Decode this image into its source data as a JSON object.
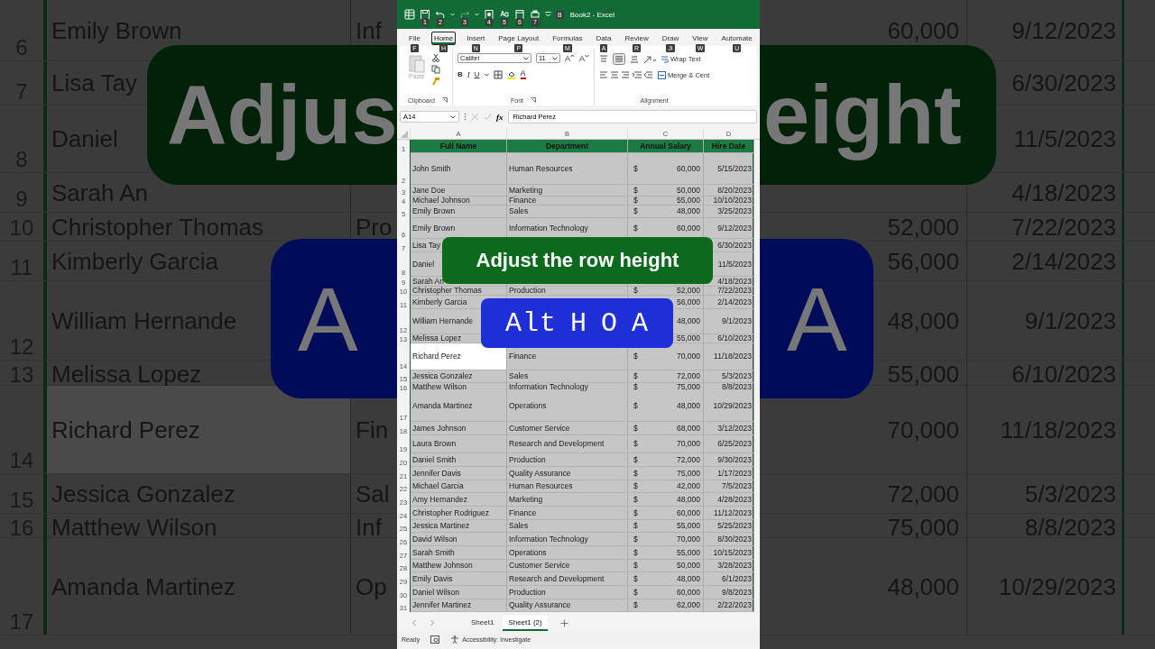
{
  "backdrop": {
    "left": {
      "rows": [
        {
          "number": "6",
          "name": "Emily Brown",
          "department": "Inf",
          "active": false
        },
        {
          "number": "7",
          "name": "Lisa Tay",
          "active": false
        },
        {
          "number": "8",
          "name": "Daniel",
          "active": false
        },
        {
          "number": "9",
          "name": "Sarah An",
          "active": false
        },
        {
          "number": "10",
          "name": "Christopher Thomas",
          "department": "Pro",
          "active": false
        },
        {
          "number": "11",
          "name": "Kimberly Garcia",
          "active": false
        },
        {
          "number": "12",
          "name": "William Hernande",
          "active": false
        },
        {
          "number": "13",
          "name": "Melissa Lopez",
          "active": false
        },
        {
          "number": "14",
          "name": "Richard Perez",
          "department": "Fin",
          "active": true
        },
        {
          "number": "15",
          "name": "Jessica Gonzalez",
          "department": "Sal",
          "active": false
        },
        {
          "number": "16",
          "name": "Matthew Wilson",
          "department": "Inf",
          "active": false
        },
        {
          "number": "17",
          "name": "Amanda Martinez",
          "department": "Op",
          "active": false
        }
      ],
      "caption": "Adjus",
      "shortcut": "A"
    },
    "right": {
      "rows": [
        {
          "salary": "60,000",
          "date": "9/12/2023"
        },
        {
          "date": "6/30/2023"
        },
        {
          "date": "11/5/2023"
        },
        {
          "date": "4/18/2023"
        },
        {
          "salary": "52,000",
          "date": "7/22/2023"
        },
        {
          "salary": "56,000",
          "date": "2/14/2023"
        },
        {
          "salary": "48,000",
          "date": "9/1/2023"
        },
        {
          "salary": "55,000",
          "date": "6/10/2023"
        },
        {
          "salary": "70,000",
          "date": "11/18/2023"
        },
        {
          "salary": "72,000",
          "date": "5/3/2023"
        },
        {
          "salary": "75,000",
          "date": "8/8/2023"
        },
        {
          "salary": "48,000",
          "date": "10/29/2023"
        }
      ],
      "caption": "eight",
      "shortcut": "A"
    }
  },
  "window": {
    "title": "Book2 - Excel",
    "title_keytip": "B",
    "quick_access": [
      {
        "kind": "save",
        "keytip": "1",
        "disabled": false
      },
      {
        "kind": "undo",
        "keytip": "2",
        "disabled": false
      },
      {
        "kind": "redo",
        "keytip": "3",
        "disabled": true
      },
      {
        "kind": "touch",
        "keytip": "4",
        "disabled": false
      },
      {
        "kind": "spelling",
        "keytip": "5",
        "disabled": false
      },
      {
        "kind": "page",
        "keytip": "6",
        "disabled": false
      },
      {
        "kind": "print",
        "keytip": "7",
        "disabled": false
      }
    ]
  },
  "ribbon": {
    "tabs": [
      {
        "label": "File",
        "keytip": "F",
        "selected": false
      },
      {
        "label": "Home",
        "keytip": "H",
        "selected": true
      },
      {
        "label": "Insert",
        "keytip": "N",
        "selected": false
      },
      {
        "label": "Page Layout",
        "keytip": "P",
        "selected": false
      },
      {
        "label": "Formulas",
        "keytip": "M",
        "selected": false
      },
      {
        "label": "Data",
        "keytip": "A",
        "selected": false
      },
      {
        "label": "Review",
        "keytip": "R",
        "selected": false
      },
      {
        "label": "Draw",
        "keytip": "JI",
        "selected": false
      },
      {
        "label": "View",
        "keytip": "W",
        "selected": false
      },
      {
        "label": "Automate",
        "keytip": "U",
        "selected": false
      }
    ],
    "clipboard": {
      "paste": {
        "label": "Paste",
        "disabled": true
      },
      "label": "Clipboard"
    },
    "font": {
      "name": "Calibri",
      "size": "11",
      "grow": "A",
      "shrink": "A",
      "bold": "B",
      "italic": "I",
      "underline": "U",
      "font_color_button": "A",
      "label": "Font"
    },
    "alignment": {
      "wrap": "Wrap Text",
      "merge": "Merge & Cent",
      "label": "Alignment"
    }
  },
  "formula_bar": {
    "name_box": "A14",
    "fx": "fx",
    "value": "Richard Perez"
  },
  "sheet": {
    "columns": [
      "A",
      "B",
      "C",
      "D"
    ],
    "rows": [
      {
        "kind": "header",
        "number": "1",
        "name": "Full Name",
        "department": "Department",
        "salary": "Annual Salary",
        "date": "Hire Date"
      },
      {
        "kind": "data",
        "number": "2",
        "name": "John Smith",
        "department": "Human Resources",
        "currency": "$",
        "salary": "60,000",
        "date": "5/15/2023",
        "active": false
      },
      {
        "kind": "data",
        "number": "3",
        "name": "Jane Doe",
        "department": "Marketing",
        "currency": "$",
        "salary": "50,000",
        "date": "8/20/2023",
        "active": false
      },
      {
        "kind": "data",
        "number": "4",
        "name": "Michael Johnson",
        "department": "Finance",
        "currency": "$",
        "salary": "55,000",
        "date": "10/10/2023",
        "active": false
      },
      {
        "kind": "data",
        "number": "5",
        "name": "Emily Brown",
        "department": "Sales",
        "currency": "$",
        "salary": "48,000",
        "date": "3/25/2023",
        "active": false
      },
      {
        "kind": "data",
        "number": "6",
        "name": "Emily Brown",
        "department": "Information Technology",
        "currency": "$",
        "salary": "60,000",
        "date": "9/12/2023",
        "active": false
      },
      {
        "kind": "data",
        "number": "7",
        "name": "Lisa Tay",
        "date": "6/30/2023",
        "active": false
      },
      {
        "kind": "data",
        "number": "8",
        "name": "Daniel",
        "date": "11/5/2023",
        "active": false
      },
      {
        "kind": "data",
        "number": "9",
        "name": "Sarah An",
        "date": "4/18/2023",
        "active": false
      },
      {
        "kind": "data",
        "number": "10",
        "name": "Christopher Thomas",
        "department": "Production",
        "currency": "$",
        "salary": "52,000",
        "date": "7/22/2023",
        "active": false
      },
      {
        "kind": "data",
        "number": "11",
        "name": "Kimberly Garcia",
        "salary": "56,000",
        "date": "2/14/2023",
        "active": false
      },
      {
        "kind": "data",
        "number": "12",
        "name": "William Hernande",
        "salary": "48,000",
        "date": "9/1/2023",
        "active": false
      },
      {
        "kind": "data",
        "number": "13",
        "name": "Melissa Lopez",
        "salary": "55,000",
        "date": "6/10/2023",
        "active": false
      },
      {
        "kind": "data",
        "number": "14",
        "name": "Richard Perez",
        "department": "Finance",
        "currency": "$",
        "salary": "70,000",
        "date": "11/18/2023",
        "active": true
      },
      {
        "kind": "data",
        "number": "15",
        "name": "Jessica Gonzalez",
        "department": "Sales",
        "currency": "$",
        "salary": "72,000",
        "date": "5/3/2023",
        "active": false
      },
      {
        "kind": "data",
        "number": "16",
        "name": "Matthew Wilson",
        "department": "Information Technology",
        "currency": "$",
        "salary": "75,000",
        "date": "8/8/2023",
        "active": false
      },
      {
        "kind": "data",
        "number": "17",
        "name": "Amanda Martinez",
        "department": "Operations",
        "currency": "$",
        "salary": "48,000",
        "date": "10/29/2023",
        "active": false
      },
      {
        "kind": "data",
        "number": "18",
        "name": "James Johnson",
        "department": "Customer Service",
        "currency": "$",
        "salary": "68,000",
        "date": "3/12/2023",
        "active": false
      },
      {
        "kind": "data",
        "number": "19",
        "name": "Laura Brown",
        "department": "Research and Development",
        "currency": "$",
        "salary": "70,000",
        "date": "6/25/2023",
        "active": false
      },
      {
        "kind": "data",
        "number": "20",
        "name": "Daniel Smith",
        "department": "Production",
        "currency": "$",
        "salary": "72,000",
        "date": "9/30/2023",
        "active": false
      },
      {
        "kind": "data",
        "number": "21",
        "name": "Jennifer Davis",
        "department": "Quality Assurance",
        "currency": "$",
        "salary": "75,000",
        "date": "1/17/2023",
        "active": false
      },
      {
        "kind": "data",
        "number": "22",
        "name": "Michael Garcia",
        "department": "Human Resources",
        "currency": "$",
        "salary": "42,000",
        "date": "7/5/2023",
        "active": false
      },
      {
        "kind": "data",
        "number": "23",
        "name": "Amy Hernandez",
        "department": "Marketing",
        "currency": "$",
        "salary": "48,000",
        "date": "4/28/2023",
        "active": false
      },
      {
        "kind": "data",
        "number": "24",
        "name": "Christopher Rodriguez",
        "department": "Finance",
        "currency": "$",
        "salary": "60,000",
        "date": "11/12/2023",
        "active": false
      },
      {
        "kind": "data",
        "number": "25",
        "name": "Jessica Martinez",
        "department": "Sales",
        "currency": "$",
        "salary": "55,000",
        "date": "5/25/2023",
        "active": false
      },
      {
        "kind": "data",
        "number": "26",
        "name": "David Wilson",
        "department": "Information Technology",
        "currency": "$",
        "salary": "70,000",
        "date": "8/30/2023",
        "active": false
      },
      {
        "kind": "data",
        "number": "27",
        "name": "Sarah Smith",
        "department": "Operations",
        "currency": "$",
        "salary": "55,000",
        "date": "10/15/2023",
        "active": false
      },
      {
        "kind": "data",
        "number": "28",
        "name": "Matthew Johnson",
        "department": "Customer Service",
        "currency": "$",
        "salary": "50,000",
        "date": "3/28/2023",
        "active": false
      },
      {
        "kind": "data",
        "number": "29",
        "name": "Emily Davis",
        "department": "Research and Development",
        "currency": "$",
        "salary": "48,000",
        "date": "6/1/2023",
        "active": false
      },
      {
        "kind": "data",
        "number": "30",
        "name": "Daniel Wilson",
        "department": "Production",
        "currency": "$",
        "salary": "60,000",
        "date": "9/8/2023",
        "active": false
      },
      {
        "kind": "data",
        "number": "31",
        "name": "Jennifer Martinez",
        "department": "Quality Assurance",
        "currency": "$",
        "salary": "62,000",
        "date": "2/22/2023",
        "active": false
      }
    ]
  },
  "sheet_tabs": [
    {
      "label": "Sheet1",
      "selected": false
    },
    {
      "label": "Sheet1 (2)",
      "selected": true
    }
  ],
  "status_bar": {
    "mode": "Ready",
    "accessibility": "Accessibility: Investigate"
  },
  "captions": {
    "title": "Adjust the row height",
    "shortcut": "Alt H O A"
  }
}
